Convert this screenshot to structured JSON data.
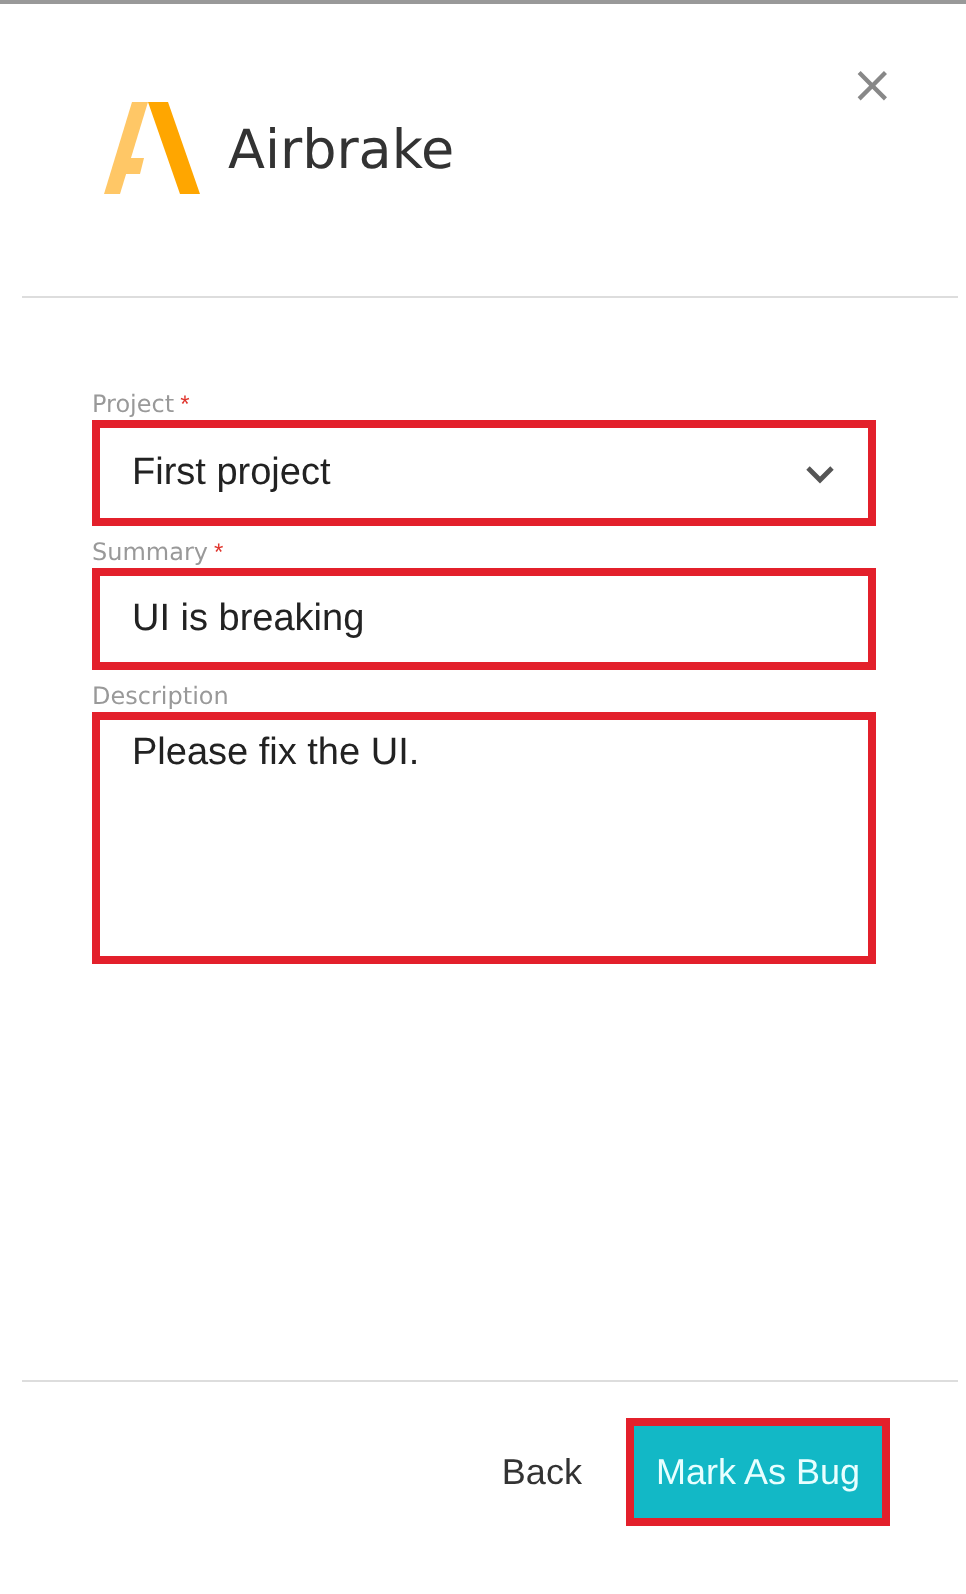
{
  "header": {
    "title": "Airbrake",
    "close": "×"
  },
  "fields": [
    {
      "kind": "select",
      "label": "Project",
      "required_mark": "*",
      "value": "First project",
      "highlighted": true
    },
    {
      "kind": "text",
      "label": "Summary",
      "required_mark": "*",
      "value": "UI is breaking",
      "highlighted": true
    },
    {
      "kind": "textarea",
      "label": "Description",
      "value": "Please fix the UI.",
      "highlighted": true
    }
  ],
  "footer": {
    "back": "Back",
    "submit": {
      "label": "Mark As Bug",
      "highlighted": true
    }
  }
}
